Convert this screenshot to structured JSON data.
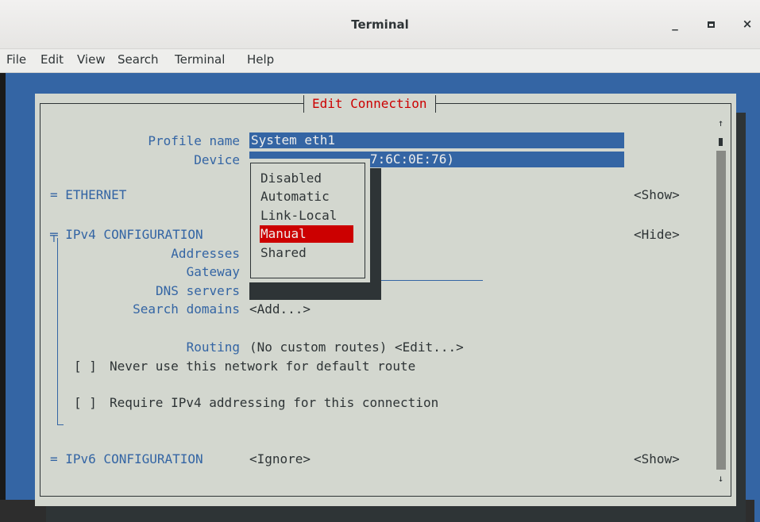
{
  "window": {
    "title": "Terminal",
    "minimize": "_",
    "close": "×"
  },
  "menu": [
    "File",
    "Edit",
    "View",
    "Search",
    "Terminal",
    "Help"
  ],
  "dialog": {
    "title": "Edit Connection",
    "profile_name_label": "Profile name",
    "profile_name_value": "System eth1",
    "device_label": "Device",
    "device_value_visible": "7:6C:0E:76)",
    "ethernet_label": "= ETHERNET",
    "ethernet_toggle": "<Show>",
    "ipv4_label": "╤ IPv4 CONFIGURATION",
    "ipv4_toggle": "<Hide>",
    "addresses_label": "Addresses",
    "gateway_label": "Gateway",
    "dns_label": "DNS servers",
    "search_domains_label": "Search domains",
    "search_domains_action": "<Add...>",
    "routing_label": "Routing",
    "routing_value": "(No custom routes) <Edit...>",
    "never_default_checkbox": "[ ]",
    "never_default_text": "Never use this network for default route",
    "require_ipv4_checkbox": "[ ]",
    "require_ipv4_text": "Require IPv4 addressing for this connection",
    "ipv6_label": "= IPv6 CONFIGURATION",
    "ipv6_value": "<Ignore>",
    "ipv6_toggle": "<Show>",
    "scroll_up": "↑",
    "scroll_down": "↓"
  },
  "popup": {
    "options": [
      "Disabled",
      "Automatic",
      "Link-Local",
      "Manual",
      "Shared"
    ],
    "selected": "Manual"
  },
  "colors": {
    "terminal_bg": "#3465a4",
    "dialog_bg": "#d3d7cf",
    "accent_red": "#cc0000",
    "text_blue": "#3465a4"
  }
}
